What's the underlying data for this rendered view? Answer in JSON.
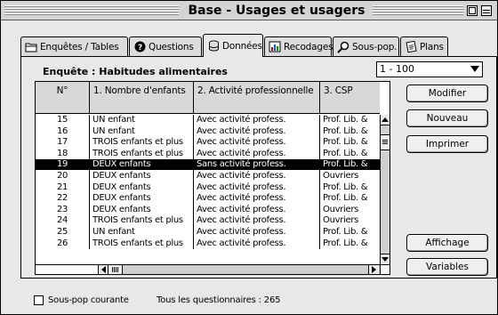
{
  "window": {
    "title": "Base - Usages et usagers"
  },
  "tabs": [
    {
      "label": "Enquêtes / Tables",
      "icon": "folder-icon"
    },
    {
      "label": "Questions",
      "icon": "question-icon"
    },
    {
      "label": "Données",
      "icon": "data-disk-icon"
    },
    {
      "label": "Recodages",
      "icon": "chart-icon"
    },
    {
      "label": "Sous-pop.",
      "icon": "magnifier-icon"
    },
    {
      "label": "Plans",
      "icon": "notepad-icon"
    }
  ],
  "survey": {
    "label": "Enquête : Habitudes alimentaires"
  },
  "range": {
    "value": "1 - 100"
  },
  "table": {
    "columns": [
      "N°",
      "1. Nombre d'enfants",
      "2. Activité professionnelle",
      "3. CSP"
    ],
    "selected_row": "19",
    "rows": [
      {
        "n": "15",
        "c1": "UN enfant",
        "c2": "Avec activité profess.",
        "c3": "Prof. Lib. &"
      },
      {
        "n": "16",
        "c1": "UN enfant",
        "c2": "Avec activité profess.",
        "c3": "Prof. Lib. &"
      },
      {
        "n": "17",
        "c1": "TROIS enfants et plus",
        "c2": "Avec activité profess.",
        "c3": "Prof. Lib. &"
      },
      {
        "n": "18",
        "c1": "TROIS enfants et plus",
        "c2": "Avec activité profess.",
        "c3": "Prof. Lib. &"
      },
      {
        "n": "19",
        "c1": "DEUX enfants",
        "c2": "Sans activité profess.",
        "c3": "Prof. Lib. &"
      },
      {
        "n": "20",
        "c1": "DEUX enfants",
        "c2": "Avec activité profess.",
        "c3": "Ouvriers"
      },
      {
        "n": "21",
        "c1": "DEUX enfants",
        "c2": "Avec activité profess.",
        "c3": "Prof. Lib. &"
      },
      {
        "n": "22",
        "c1": "DEUX enfants",
        "c2": "Avec activité profess.",
        "c3": "Prof. Lib. &"
      },
      {
        "n": "23",
        "c1": "DEUX enfants",
        "c2": "Avec activité profess.",
        "c3": "Ouvriers"
      },
      {
        "n": "24",
        "c1": "TROIS enfants et plus",
        "c2": "Avec activité profess.",
        "c3": "Ouvriers"
      },
      {
        "n": "25",
        "c1": "UN enfant",
        "c2": "Avec activité profess.",
        "c3": "Prof. Lib. &"
      },
      {
        "n": "26",
        "c1": "TROIS enfants et plus",
        "c2": "Avec activité profess.",
        "c3": "Prof. Lib. &"
      }
    ]
  },
  "buttons": {
    "modifier": "Modifier",
    "nouveau": "Nouveau",
    "imprimer": "Imprimer",
    "affichage": "Affichage",
    "variables": "Variables"
  },
  "footer": {
    "subpop_label": "Sous-pop courante",
    "subpop_checked": false,
    "count_label": "Tous les questionnaires : 265"
  },
  "colors": {
    "window_bg": "#e8e8e8",
    "selection": "#000000",
    "title_bar": "#d4d4d4"
  }
}
